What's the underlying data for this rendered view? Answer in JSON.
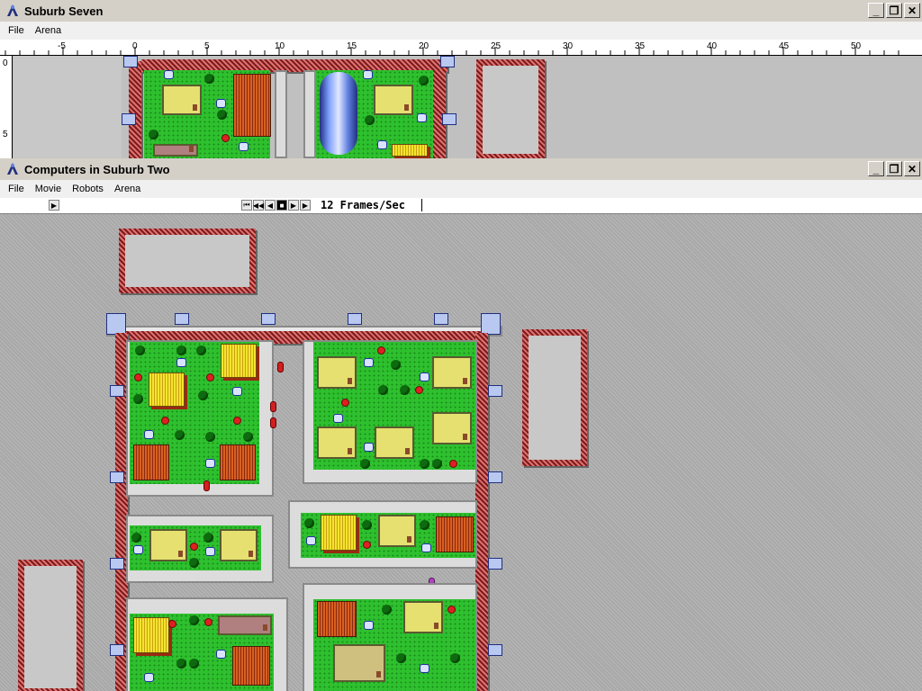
{
  "top_window": {
    "title": "Suburb Seven",
    "menu": [
      "File",
      "Arena"
    ],
    "ruler": {
      "x_labels": [
        "-5",
        "0",
        "5",
        "10",
        "15",
        "20",
        "25",
        "30",
        "35",
        "40",
        "45",
        "50"
      ],
      "y_labels": [
        "0",
        "5"
      ]
    }
  },
  "bottom_window": {
    "title": "Computers in Suburb Two",
    "menu": [
      "File",
      "Movie",
      "Robots",
      "Arena"
    ],
    "playback": {
      "frame_rate": "12 Frames/Sec"
    }
  },
  "window_buttons": {
    "minimize": "_",
    "restore": "❐",
    "close": "✕"
  }
}
